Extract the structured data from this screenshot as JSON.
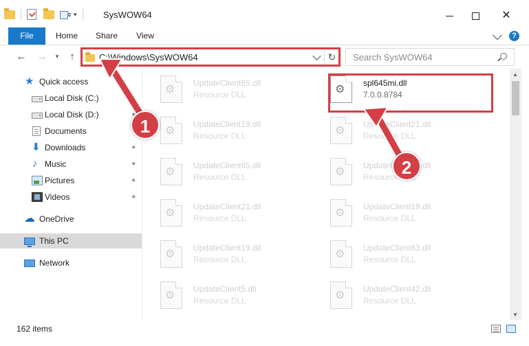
{
  "window": {
    "title": "SysWOW64",
    "controls": {
      "minimize": "–",
      "maximize": "□",
      "close": "✕"
    }
  },
  "ribbon": {
    "tabs": [
      {
        "label": "File"
      },
      {
        "label": "Home"
      },
      {
        "label": "Share"
      },
      {
        "label": "View"
      }
    ],
    "help": "?"
  },
  "nav": {
    "back": "←",
    "forward": "→",
    "recent": "▾",
    "up": "↑",
    "address": "C:\\Windows\\SysWOW64",
    "refresh": "↻",
    "search_placeholder": "Search SysWOW64"
  },
  "sidebar": {
    "items": [
      {
        "label": "Quick access",
        "icon": "star-icon"
      },
      {
        "label": "Local Disk (C:)",
        "icon": "drive-icon",
        "pinned": true
      },
      {
        "label": "Local Disk (D:)",
        "icon": "drive-icon",
        "pinned": true
      },
      {
        "label": "Documents",
        "icon": "documents-icon",
        "pinned": true
      },
      {
        "label": "Downloads",
        "icon": "download-icon",
        "pinned": true
      },
      {
        "label": "Music",
        "icon": "music-icon",
        "pinned": true
      },
      {
        "label": "Pictures",
        "icon": "pictures-icon",
        "pinned": true
      },
      {
        "label": "Videos",
        "icon": "videos-icon",
        "pinned": true
      },
      {
        "label": "OneDrive",
        "icon": "onedrive-icon"
      },
      {
        "label": "This PC",
        "icon": "pc-icon",
        "selected": true
      },
      {
        "label": "Network",
        "icon": "network-icon"
      }
    ],
    "pin_glyph": "📌"
  },
  "files": [
    {
      "name": "UpdateClient65.dll",
      "type": "Resource DLL"
    },
    {
      "name": "spl645mi.dll",
      "type": "7.0.0.8784",
      "active": true
    },
    {
      "name": "UpdateClient19.dll",
      "type": "Resource DLL"
    },
    {
      "name": "UpdateClient21.dll",
      "type": "Resource DLL"
    },
    {
      "name": "UpdateClient65.dll",
      "type": "Resource DLL"
    },
    {
      "name": "UpdateClient62.dll",
      "type": "Resource DLL"
    },
    {
      "name": "UpdateClient21.dll",
      "type": "Resource DLL"
    },
    {
      "name": "UpdateClient19.dll",
      "type": "Resource DLL"
    },
    {
      "name": "UpdateClient19.dll",
      "type": "Resource DLL"
    },
    {
      "name": "UpdateClient63.dll",
      "type": "Resource DLL"
    },
    {
      "name": "UpdateClient5.dll",
      "type": "Resource DLL"
    },
    {
      "name": "UpdateClient42.dll",
      "type": "Resource DLL"
    }
  ],
  "status": {
    "item_count": "162 items"
  },
  "annotations": {
    "step1": "1",
    "step2": "2",
    "color": "#d33f45"
  },
  "colors": {
    "accent": "#1979ca",
    "highlight": "#d33f45"
  }
}
